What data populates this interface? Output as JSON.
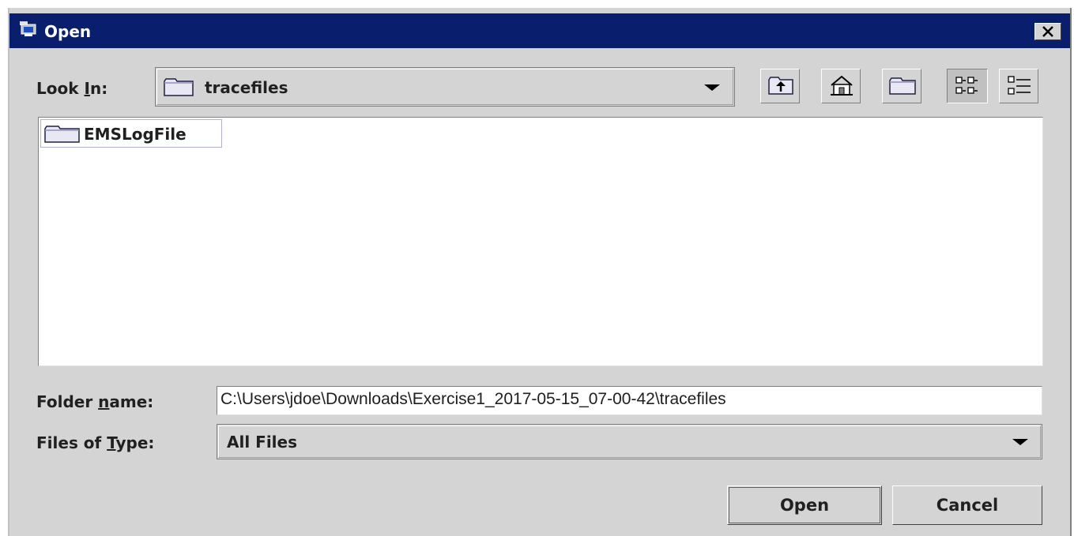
{
  "window": {
    "title": "Open",
    "close_label": "close"
  },
  "look_in": {
    "label_pre": "Look ",
    "label_mnemonic": "I",
    "label_post": "n:",
    "value": "tracefiles",
    "icon": "folder-icon"
  },
  "toolbar": {
    "buttons": [
      {
        "name": "up-one-level",
        "icon": "up-folder-icon"
      },
      {
        "name": "home",
        "icon": "home-icon"
      },
      {
        "name": "create-new-folder",
        "icon": "new-folder-icon"
      },
      {
        "name": "list-view",
        "icon": "list-view-icon",
        "selected": true
      },
      {
        "name": "details-view",
        "icon": "details-view-icon",
        "selected": false
      }
    ]
  },
  "file_list": {
    "items": [
      {
        "name": "EMSLogFile",
        "icon": "folder-icon"
      }
    ]
  },
  "folder_name": {
    "label_pre": "Folder ",
    "label_mnemonic": "n",
    "label_post": "ame:",
    "value": "C:\\Users\\jdoe\\Downloads\\Exercise1_2017-05-15_07-00-42\\tracefiles"
  },
  "files_of_type": {
    "label_pre": "Files of ",
    "label_mnemonic": "T",
    "label_post": "ype:",
    "value": "All Files"
  },
  "buttons": {
    "open_label": "Open",
    "cancel_label": "Cancel"
  },
  "colors": {
    "titlebar": "#0a1e6e",
    "dialog_bg": "#d4d4d4"
  }
}
